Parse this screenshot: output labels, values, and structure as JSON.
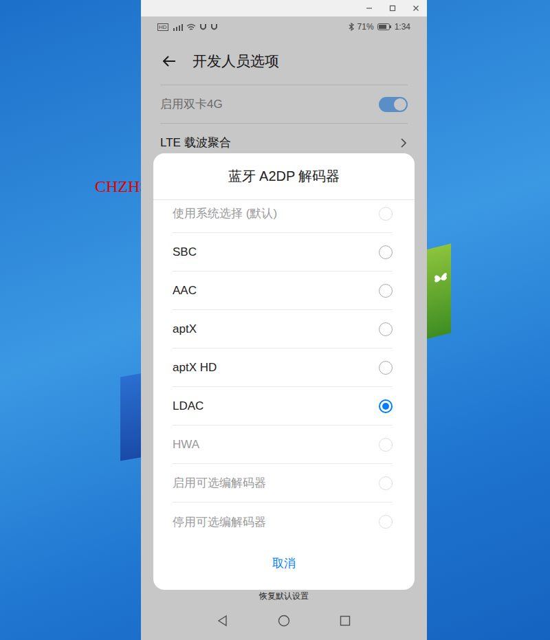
{
  "watermark": "CHZHSSR",
  "status_bar": {
    "left_badge": "HD",
    "battery": "71%",
    "time": "1:34"
  },
  "page": {
    "title": "开发人员选项",
    "settings": [
      {
        "label": "启用双卡4G",
        "kind": "toggle",
        "on": true,
        "disabled": true
      },
      {
        "label": "LTE 载波聚合",
        "kind": "link",
        "disabled": false
      }
    ],
    "footer_partial": "恢复默认设置"
  },
  "dialog": {
    "title": "蓝牙 A2DP 解码器",
    "options": [
      {
        "label": "使用系统选择 (默认)",
        "selected": false,
        "disabled": true
      },
      {
        "label": "SBC",
        "selected": false,
        "disabled": false
      },
      {
        "label": "AAC",
        "selected": false,
        "disabled": false
      },
      {
        "label": "aptX",
        "selected": false,
        "disabled": false
      },
      {
        "label": "aptX HD",
        "selected": false,
        "disabled": false
      },
      {
        "label": "LDAC",
        "selected": true,
        "disabled": false
      },
      {
        "label": "HWA",
        "selected": false,
        "disabled": true
      },
      {
        "label": "启用可选编解码器",
        "selected": false,
        "disabled": true
      },
      {
        "label": "停用可选编解码器",
        "selected": false,
        "disabled": true
      }
    ],
    "cancel": "取消"
  }
}
